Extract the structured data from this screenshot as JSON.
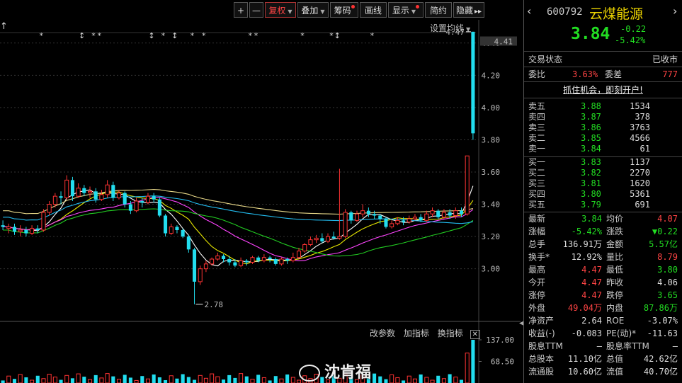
{
  "toolbar": {
    "items": [
      {
        "label": "+",
        "name": "zoom-in-button"
      },
      {
        "label": "—",
        "name": "zoom-out-button"
      },
      {
        "label": "复权",
        "name": "fuquan-button",
        "caret": true,
        "active": true
      },
      {
        "label": "叠加",
        "name": "overlay-button",
        "caret": true
      },
      {
        "label": "筹码",
        "name": "chips-button",
        "dot": true
      },
      {
        "label": "画线",
        "name": "draw-line-button"
      },
      {
        "label": "显示",
        "name": "display-button",
        "caret": true,
        "dot": true
      },
      {
        "label": "简约",
        "name": "simple-button"
      },
      {
        "label": "隐藏",
        "name": "hide-button",
        "arrows": "▸▸"
      }
    ],
    "settings_ma": "设置均线"
  },
  "price_axis": [
    "4.40",
    "4.20",
    "4.00",
    "3.80",
    "3.60",
    "3.40",
    "3.20",
    "3.00"
  ],
  "price_current": "4.41",
  "annotations": {
    "high": "4.47",
    "low": "2.78"
  },
  "volume_toolbar": {
    "params": "改参数",
    "add": "加指标",
    "switch": "换指标",
    "close": "✕"
  },
  "volume_axis": [
    "137.00",
    "68.50"
  ],
  "watermark": "沈肯福",
  "stock": {
    "code": "600792",
    "name": "云煤能源",
    "price": "3.84",
    "change": "-0.22",
    "change_pct": "-5.42%"
  },
  "status": {
    "label": "交易状态",
    "value": "已收市"
  },
  "ratio": {
    "wb_label": "委比",
    "wb_value": "3.63%",
    "wc_label": "委差",
    "wc_value": "777"
  },
  "promo": "抓住机会，即刻开户!",
  "asks": [
    {
      "label": "卖五",
      "price": "3.88",
      "vol": "1534"
    },
    {
      "label": "卖四",
      "price": "3.87",
      "vol": "378"
    },
    {
      "label": "卖三",
      "price": "3.86",
      "vol": "3763"
    },
    {
      "label": "卖二",
      "price": "3.85",
      "vol": "4566"
    },
    {
      "label": "卖一",
      "price": "3.84",
      "vol": "61"
    }
  ],
  "bids": [
    {
      "label": "买一",
      "price": "3.83",
      "vol": "1137"
    },
    {
      "label": "买二",
      "price": "3.82",
      "vol": "2270"
    },
    {
      "label": "买三",
      "price": "3.81",
      "vol": "1620"
    },
    {
      "label": "买四",
      "price": "3.80",
      "vol": "5361"
    },
    {
      "label": "买五",
      "price": "3.79",
      "vol": "691"
    }
  ],
  "stats": [
    {
      "l1": "最新",
      "v1": "3.84",
      "c1": "green",
      "l2": "均价",
      "v2": "4.07",
      "c2": "red"
    },
    {
      "l1": "涨幅",
      "v1": "-5.42%",
      "c1": "green",
      "l2": "涨跌",
      "v2": "▼0.22",
      "c2": "green"
    },
    {
      "l1": "总手",
      "v1": "136.91万",
      "c1": "white",
      "l2": "金额",
      "v2": "5.57亿",
      "c2": "green"
    },
    {
      "l1": "换手*",
      "v1": "12.92%",
      "c1": "white",
      "l2": "量比",
      "v2": "8.79",
      "c2": "red"
    },
    {
      "l1": "最高",
      "v1": "4.47",
      "c1": "red",
      "l2": "最低",
      "v2": "3.80",
      "c2": "green"
    },
    {
      "l1": "今开",
      "v1": "4.47",
      "c1": "red",
      "l2": "昨收",
      "v2": "4.06",
      "c2": "white"
    },
    {
      "l1": "涨停",
      "v1": "4.47",
      "c1": "red",
      "l2": "跌停",
      "v2": "3.65",
      "c2": "green"
    },
    {
      "l1": "外盘",
      "v1": "49.04万",
      "c1": "red",
      "l2": "内盘",
      "v2": "87.86万",
      "c2": "green"
    },
    {
      "l1": "净资产",
      "v1": "2.64",
      "c1": "white",
      "l2": "ROE",
      "v2": "-3.07%",
      "c2": "white"
    },
    {
      "l1": "收益(-)",
      "v1": "-0.083",
      "c1": "white",
      "l2": "PE(动)*",
      "v2": "-11.63",
      "c2": "white"
    },
    {
      "l1": "股息TTM",
      "v1": "—",
      "c1": "white",
      "l2": "股息率TTM",
      "v2": "—",
      "c2": "white"
    },
    {
      "l1": "总股本",
      "v1": "11.10亿",
      "c1": "white",
      "l2": "总值",
      "v2": "42.62亿",
      "c2": "white"
    },
    {
      "l1": "流通股",
      "v1": "10.60亿",
      "c1": "white",
      "l2": "流值",
      "v2": "40.70亿",
      "c2": "white"
    }
  ],
  "chart_data": {
    "type": "candlestick",
    "price_range": [
      2.7,
      4.5
    ],
    "candles": [
      [
        3.27,
        3.26,
        3.24,
        3.3
      ],
      [
        3.25,
        3.26,
        3.22,
        3.28
      ],
      [
        3.26,
        3.23,
        3.21,
        3.28
      ],
      [
        3.23,
        3.24,
        3.2,
        3.27
      ],
      [
        3.24,
        3.22,
        3.2,
        3.26
      ],
      [
        3.22,
        3.25,
        3.21,
        3.27
      ],
      [
        3.25,
        3.24,
        3.22,
        3.27
      ],
      [
        3.24,
        3.35,
        3.23,
        3.37
      ],
      [
        3.35,
        3.4,
        3.33,
        3.42
      ],
      [
        3.4,
        3.45,
        3.38,
        3.47
      ],
      [
        3.45,
        3.44,
        3.4,
        3.48
      ],
      [
        3.44,
        3.55,
        3.43,
        3.58
      ],
      [
        3.55,
        3.45,
        3.42,
        3.57
      ],
      [
        3.45,
        3.5,
        3.44,
        3.53
      ],
      [
        3.5,
        3.47,
        3.45,
        3.52
      ],
      [
        3.47,
        3.48,
        3.44,
        3.51
      ],
      [
        3.48,
        3.43,
        3.41,
        3.5
      ],
      [
        3.43,
        3.46,
        3.42,
        3.49
      ],
      [
        3.46,
        3.52,
        3.44,
        3.55
      ],
      [
        3.52,
        3.44,
        3.42,
        3.54
      ],
      [
        3.44,
        3.47,
        3.43,
        3.49
      ],
      [
        3.47,
        3.4,
        3.38,
        3.48
      ],
      [
        3.4,
        3.36,
        3.34,
        3.42
      ],
      [
        3.36,
        3.42,
        3.35,
        3.44
      ],
      [
        3.42,
        3.41,
        3.38,
        3.44
      ],
      [
        3.41,
        3.45,
        3.4,
        3.47
      ],
      [
        3.45,
        3.43,
        3.41,
        3.47
      ],
      [
        3.43,
        3.33,
        3.32,
        3.44
      ],
      [
        3.33,
        3.22,
        3.2,
        3.34
      ],
      [
        3.22,
        3.26,
        3.21,
        3.28
      ],
      [
        3.26,
        3.24,
        3.22,
        3.27
      ],
      [
        3.24,
        3.2,
        3.19,
        3.25
      ],
      [
        3.2,
        3.12,
        3.1,
        3.21
      ],
      [
        3.12,
        2.92,
        2.78,
        3.13
      ],
      [
        2.92,
        3.0,
        2.9,
        3.02
      ],
      [
        3.0,
        3.03,
        2.98,
        3.05
      ],
      [
        3.03,
        3.06,
        3.02,
        3.07
      ],
      [
        3.06,
        3.08,
        3.05,
        3.1
      ],
      [
        3.08,
        3.06,
        3.04,
        3.09
      ],
      [
        3.06,
        3.04,
        3.02,
        3.08
      ],
      [
        3.04,
        3.02,
        3.01,
        3.06
      ],
      [
        3.02,
        3.05,
        3.01,
        3.07
      ],
      [
        3.05,
        3.04,
        3.02,
        3.06
      ],
      [
        3.04,
        3.07,
        3.03,
        3.08
      ],
      [
        3.07,
        3.05,
        3.04,
        3.08
      ],
      [
        3.05,
        3.07,
        3.04,
        3.09
      ],
      [
        3.07,
        3.06,
        3.04,
        3.08
      ],
      [
        3.06,
        3.03,
        3.02,
        3.07
      ],
      [
        3.03,
        3.06,
        3.02,
        3.07
      ],
      [
        3.06,
        3.05,
        3.03,
        3.07
      ],
      [
        3.05,
        3.07,
        3.04,
        3.1
      ],
      [
        3.07,
        3.11,
        3.06,
        3.13
      ],
      [
        3.11,
        3.15,
        3.1,
        3.16
      ],
      [
        3.15,
        3.18,
        3.14,
        3.2
      ],
      [
        3.18,
        3.19,
        3.16,
        3.21
      ],
      [
        3.19,
        3.17,
        3.16,
        3.22
      ],
      [
        3.17,
        3.2,
        3.16,
        3.22
      ],
      [
        3.2,
        3.19,
        3.18,
        3.23
      ],
      [
        3.19,
        3.2,
        3.18,
        3.62
      ],
      [
        3.2,
        3.35,
        3.19,
        3.37
      ],
      [
        3.35,
        3.3,
        3.28,
        3.36
      ],
      [
        3.3,
        3.34,
        3.29,
        3.36
      ],
      [
        3.34,
        3.36,
        3.32,
        3.4
      ],
      [
        3.36,
        3.34,
        3.32,
        3.38
      ],
      [
        3.34,
        3.33,
        3.31,
        3.36
      ],
      [
        3.33,
        3.31,
        3.28,
        3.34
      ],
      [
        3.31,
        3.26,
        3.25,
        3.32
      ],
      [
        3.26,
        3.28,
        3.25,
        3.3
      ],
      [
        3.28,
        3.3,
        3.27,
        3.32
      ],
      [
        3.3,
        3.29,
        3.27,
        3.32
      ],
      [
        3.29,
        3.31,
        3.28,
        3.33
      ],
      [
        3.31,
        3.32,
        3.3,
        3.34
      ],
      [
        3.32,
        3.3,
        3.29,
        3.34
      ],
      [
        3.3,
        3.34,
        3.29,
        3.36
      ],
      [
        3.34,
        3.36,
        3.32,
        3.38
      ],
      [
        3.36,
        3.32,
        3.31,
        3.37
      ],
      [
        3.32,
        3.35,
        3.31,
        3.37
      ],
      [
        3.35,
        3.33,
        3.31,
        3.37
      ],
      [
        3.33,
        3.36,
        3.31,
        3.38
      ],
      [
        3.36,
        3.34,
        3.32,
        3.38
      ],
      [
        3.34,
        3.7,
        3.33,
        3.7
      ],
      [
        4.47,
        3.84,
        3.8,
        4.47
      ]
    ],
    "volume_range": [
      0,
      137
    ]
  }
}
